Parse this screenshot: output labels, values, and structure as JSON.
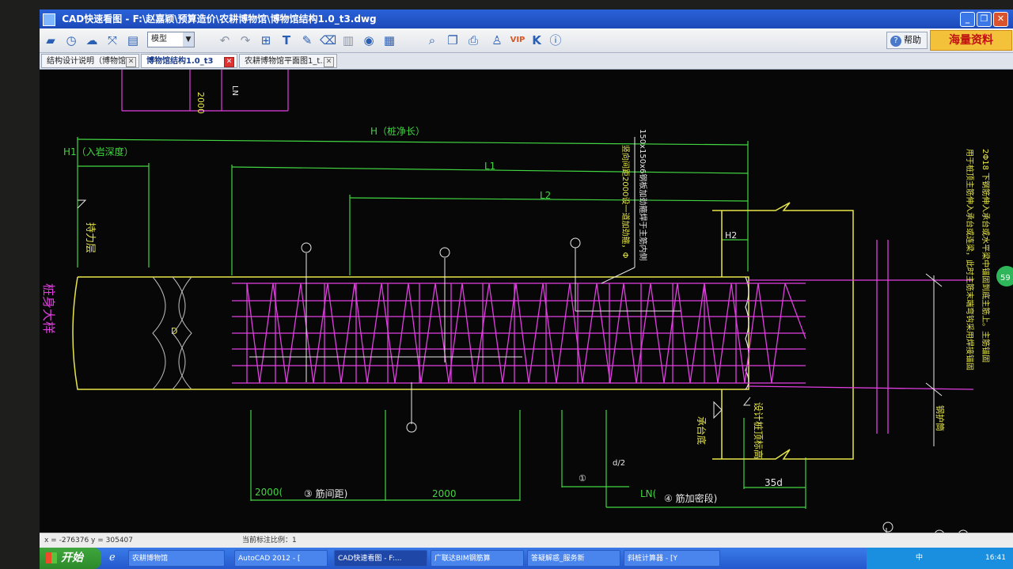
{
  "window": {
    "title": "CAD快速看图 - F:\\赵嘉颖\\预算造价\\农耕博物馆\\博物馆结构1.0_t3.dwg",
    "buttons": {
      "minimize": "_",
      "restore": "❐",
      "close": "✕"
    }
  },
  "toolbar": {
    "layout_select": "模型",
    "help_label": "帮助",
    "ad_label": "海量资料",
    "icons": [
      "open-icon",
      "history-icon",
      "cloud-icon",
      "fit-screen-icon",
      "layer-icon",
      "undo-icon",
      "redo-icon",
      "measure-icon",
      "text-icon",
      "pen-icon",
      "eraser-icon",
      "delete-icon",
      "visibility-icon",
      "layers-manager-icon",
      "search-icon",
      "compare-icon",
      "print-icon",
      "user-icon",
      "vip-icon",
      "k-icon",
      "info-icon"
    ]
  },
  "tabs": [
    {
      "label": "结构设计说明（博物馆…",
      "active": false
    },
    {
      "label": "博物馆结构1.0_t3",
      "active": true
    },
    {
      "label": "农耕博物馆平面图1_t…",
      "active": false
    }
  ],
  "drawing": {
    "top_table": {
      "v1": "2000",
      "v2": "LN"
    },
    "dim_H": "H（桩净长）",
    "dim_H1": "H1（入岩深度）",
    "dim_L1": "L1",
    "dim_L2": "L2",
    "dim_H2": "H2",
    "dim_D": "D",
    "label_layer": "持力层",
    "label_pile": "桩身大样",
    "note_center_a": "150x150x6钢板加劲箍焊于主筋内侧",
    "note_center_b": "竖向间距2000设一道加劲箍，Φ",
    "note_right_a": "2Φ18 下钢筋伸入承台或水平梁中锚固到底主筋上。主筋锚固",
    "note_right_b": "用于桩顶主筋伸入承台或连梁，此时主筋末端弯钩采用焊接锚固",
    "label_cap_bottom": "承台底",
    "label_design_top": "设计桩顶标高",
    "dim_2000_left": "2000(",
    "note_3": "③ 筋间距)",
    "dim_2000_right": "2000",
    "label_circ_1": "①",
    "label_frac": "d/2",
    "dim_LN": "LN(",
    "note_4": "④ 筋加密段)",
    "dim_35d": "35d",
    "label_anchor": "钢护筒",
    "green_badge": "59"
  },
  "status": {
    "coords": "x = -276376  y = 305407",
    "scale": "当前标注比例：1"
  },
  "taskbar": {
    "start_label": "开始",
    "tasks": [
      "农耕博物馆",
      "AutoCAD 2012 - [",
      "CAD快速看图 - F:...",
      "广联达BIM钢筋算",
      "答疑解惑_服务新",
      "斜桩计算器 - [Y"
    ],
    "tray_ime": "中",
    "tray_time": "16:41"
  },
  "colors": {
    "green": "#41d641",
    "magenta": "#e13ee1",
    "yellow": "#e6e64a",
    "white": "#e8e8e8"
  }
}
